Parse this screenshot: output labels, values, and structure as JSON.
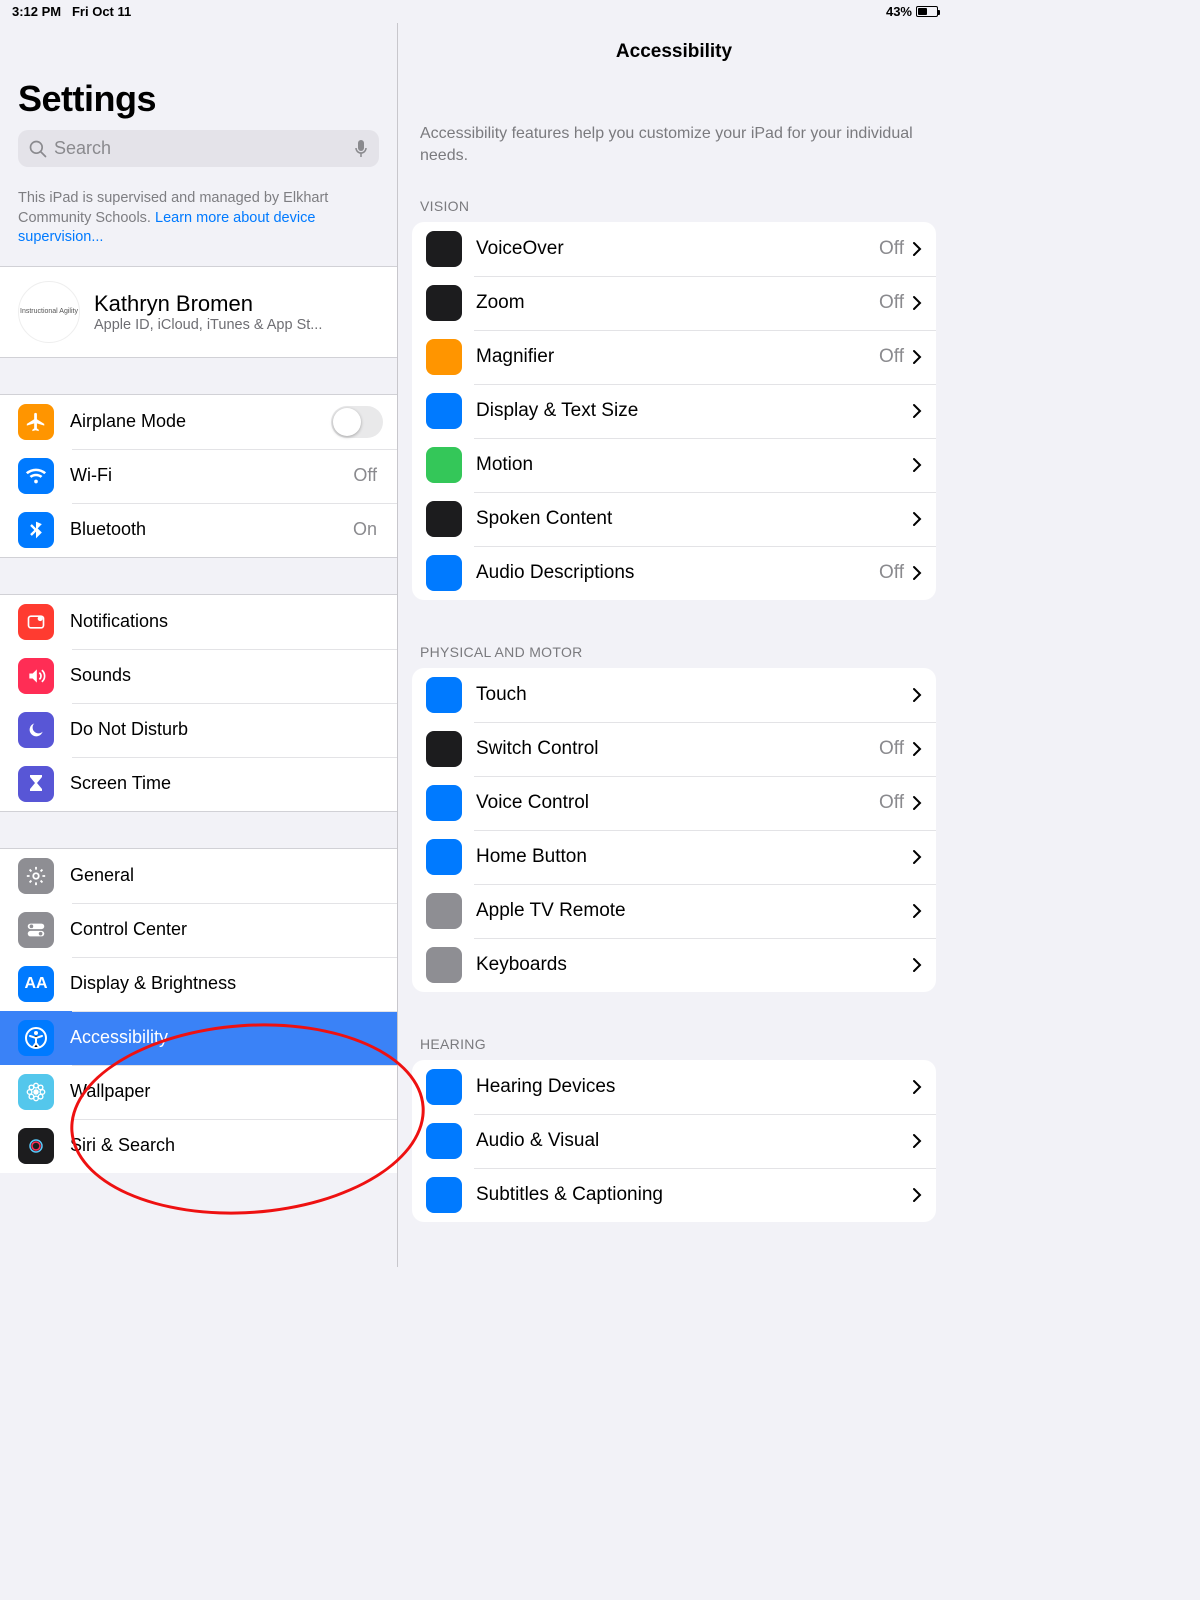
{
  "status": {
    "time": "3:12 PM",
    "date": "Fri Oct 11",
    "battery": "43%"
  },
  "sidebar": {
    "title": "Settings",
    "search_placeholder": "Search",
    "supervision_text": "This iPad is supervised and managed by Elkhart Community Schools. ",
    "supervision_link": "Learn more about device supervision...",
    "account": {
      "avatar_text": "Instructional Agility",
      "name": "Kathryn Bromen",
      "sub": "Apple ID, iCloud, iTunes & App St..."
    },
    "g1": [
      {
        "label": "Airplane Mode",
        "value": "",
        "icon": "airplane",
        "bg": "#ff9500",
        "toggle": true
      },
      {
        "label": "Wi-Fi",
        "value": "Off",
        "icon": "wifi",
        "bg": "#007aff"
      },
      {
        "label": "Bluetooth",
        "value": "On",
        "icon": "bluetooth",
        "bg": "#007aff"
      }
    ],
    "g2": [
      {
        "label": "Notifications",
        "icon": "bell",
        "bg": "#ff3b30"
      },
      {
        "label": "Sounds",
        "icon": "speaker",
        "bg": "#ff2d55"
      },
      {
        "label": "Do Not Disturb",
        "icon": "moon",
        "bg": "#5856d6"
      },
      {
        "label": "Screen Time",
        "icon": "hourglass",
        "bg": "#5856d6"
      }
    ],
    "g3": [
      {
        "label": "General",
        "icon": "gear",
        "bg": "#8e8e93"
      },
      {
        "label": "Control Center",
        "icon": "toggles",
        "bg": "#8e8e93"
      },
      {
        "label": "Display & Brightness",
        "icon": "aa",
        "bg": "#007aff"
      },
      {
        "label": "Accessibility",
        "icon": "acc",
        "bg": "#007aff",
        "selected": true
      },
      {
        "label": "Wallpaper",
        "icon": "flower",
        "bg": "#54c7ec"
      },
      {
        "label": "Siri & Search",
        "icon": "siri",
        "bg": "#1c1c1e"
      }
    ]
  },
  "detail": {
    "title": "Accessibility",
    "desc": "Accessibility features help you customize your iPad for your individual needs.",
    "sections": [
      {
        "header": "VISION",
        "rows": [
          {
            "label": "VoiceOver",
            "value": "Off",
            "bg": "#1c1c1e"
          },
          {
            "label": "Zoom",
            "value": "Off",
            "bg": "#1c1c1e"
          },
          {
            "label": "Magnifier",
            "value": "Off",
            "bg": "#ff9500"
          },
          {
            "label": "Display & Text Size",
            "value": "",
            "bg": "#007aff"
          },
          {
            "label": "Motion",
            "value": "",
            "bg": "#34c759"
          },
          {
            "label": "Spoken Content",
            "value": "",
            "bg": "#1c1c1e"
          },
          {
            "label": "Audio Descriptions",
            "value": "Off",
            "bg": "#007aff"
          }
        ]
      },
      {
        "header": "PHYSICAL AND MOTOR",
        "rows": [
          {
            "label": "Touch",
            "value": "",
            "bg": "#007aff"
          },
          {
            "label": "Switch Control",
            "value": "Off",
            "bg": "#1c1c1e"
          },
          {
            "label": "Voice Control",
            "value": "Off",
            "bg": "#007aff"
          },
          {
            "label": "Home Button",
            "value": "",
            "bg": "#007aff"
          },
          {
            "label": "Apple TV Remote",
            "value": "",
            "bg": "#8e8e93"
          },
          {
            "label": "Keyboards",
            "value": "",
            "bg": "#8e8e93"
          }
        ]
      },
      {
        "header": "HEARING",
        "rows": [
          {
            "label": "Hearing Devices",
            "value": "",
            "bg": "#007aff"
          },
          {
            "label": "Audio & Visual",
            "value": "",
            "bg": "#007aff"
          },
          {
            "label": "Subtitles & Captioning",
            "value": "",
            "bg": "#007aff"
          }
        ]
      }
    ]
  }
}
